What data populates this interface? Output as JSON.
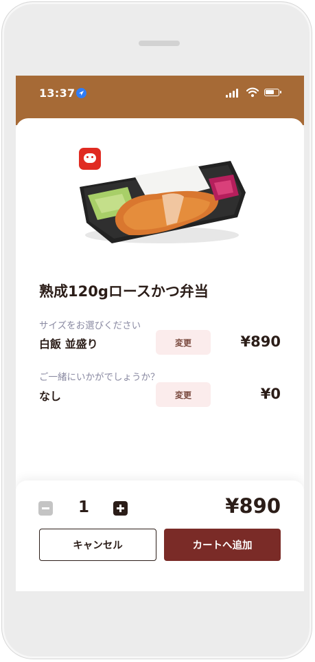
{
  "status_bar": {
    "time": "13:37"
  },
  "product": {
    "name": "熟成120gロースかつ弁当"
  },
  "options": [
    {
      "label": "サイズをお選びください",
      "value": "白飯 並盛り",
      "change_label": "変更",
      "price": "¥890"
    },
    {
      "label": "ご一緒にいかがでしょうか？",
      "value": "なし",
      "change_label": "変更",
      "price": "¥0"
    }
  ],
  "footer": {
    "quantity": "1",
    "total": "¥890",
    "cancel_label": "キャンセル",
    "add_to_cart_label": "カートへ追加"
  },
  "colors": {
    "header_brown": "#a66a36",
    "primary_button": "#7a2b27",
    "change_button_bg": "#fbecec",
    "logo_red": "#e02b22"
  },
  "icons": [
    "location-arrow-icon",
    "signal-icon",
    "wifi-icon",
    "battery-icon",
    "brand-pig-logo",
    "minus-icon",
    "plus-icon"
  ]
}
